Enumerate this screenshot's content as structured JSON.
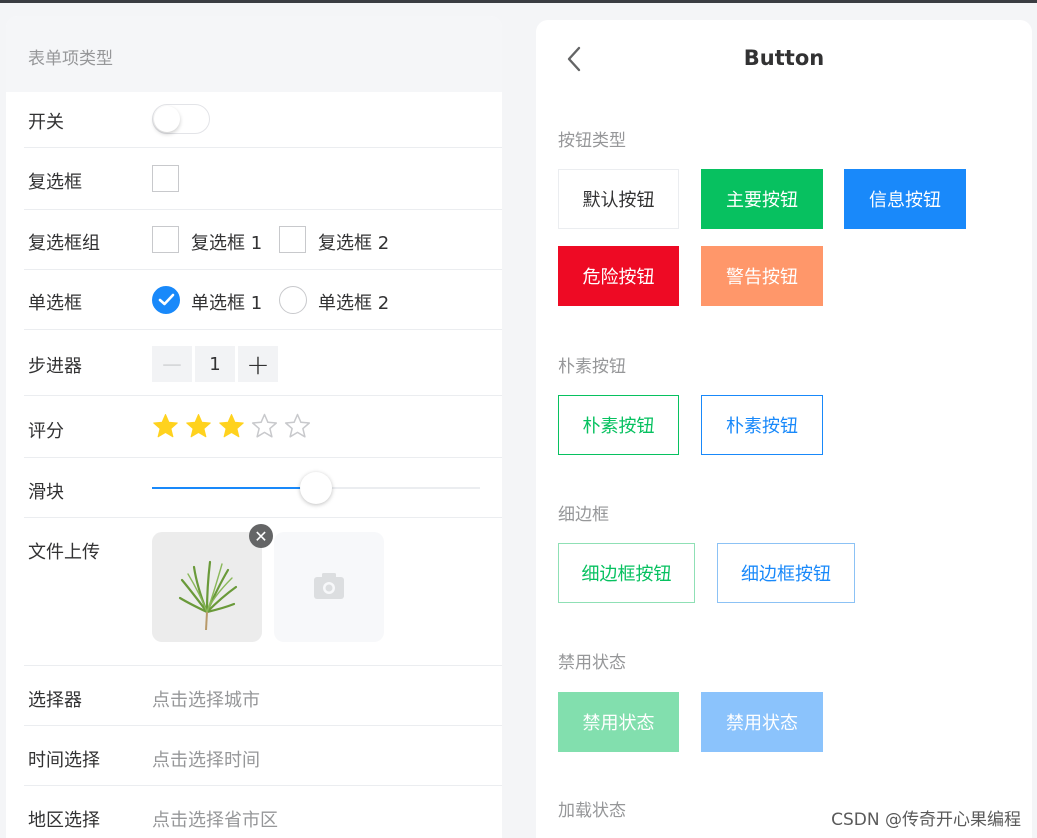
{
  "left": {
    "header": "表单项类型",
    "rows": {
      "switch": {
        "label": "开关"
      },
      "checkbox": {
        "label": "复选框"
      },
      "checkbox_group": {
        "label": "复选框组",
        "options": [
          "复选框 1",
          "复选框 2"
        ]
      },
      "radio": {
        "label": "单选框",
        "options": [
          "单选框 1",
          "单选框 2"
        ],
        "selected": 0
      },
      "stepper": {
        "label": "步进器",
        "value": "1"
      },
      "rate": {
        "label": "评分",
        "value": 3,
        "max": 5
      },
      "slider": {
        "label": "滑块",
        "value_percent": 50
      },
      "uploader": {
        "label": "文件上传"
      },
      "picker": {
        "label": "选择器",
        "placeholder": "点击选择城市"
      },
      "datetime": {
        "label": "时间选择",
        "placeholder": "点击选择时间"
      },
      "area": {
        "label": "地区选择",
        "placeholder": "点击选择省市区"
      }
    }
  },
  "right": {
    "title": "Button",
    "sections": {
      "types": {
        "title": "按钮类型",
        "buttons": [
          "默认按钮",
          "主要按钮",
          "信息按钮",
          "危险按钮",
          "警告按钮"
        ]
      },
      "plain": {
        "title": "朴素按钮",
        "buttons": [
          "朴素按钮",
          "朴素按钮"
        ]
      },
      "hairline": {
        "title": "细边框",
        "buttons": [
          "细边框按钮",
          "细边框按钮"
        ]
      },
      "disabled": {
        "title": "禁用状态",
        "buttons": [
          "禁用状态",
          "禁用状态"
        ]
      },
      "loading": {
        "title": "加载状态"
      }
    }
  },
  "colors": {
    "primary": "#07c160",
    "info": "#1989fa",
    "danger": "#ee0a24",
    "warning": "#ff976a",
    "star_active": "#ffd21e"
  },
  "watermark": "CSDN @传奇开心果编程"
}
